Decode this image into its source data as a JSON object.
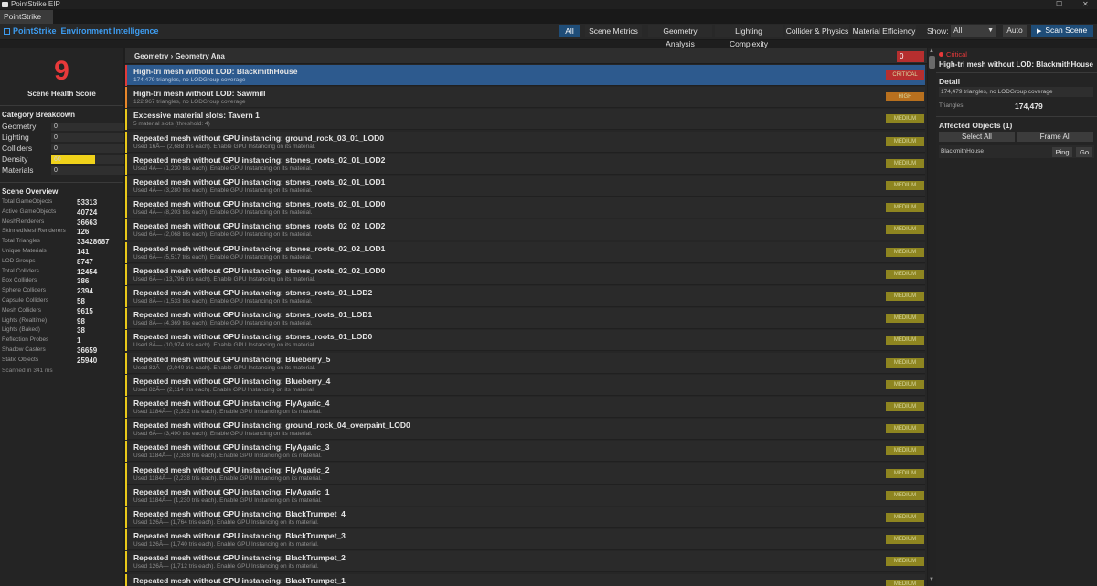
{
  "window": {
    "title": "PointStrike EIP",
    "tab": "PointStrike EIP"
  },
  "header": {
    "brand_prefix": "PointStrike",
    "brand_suffix": "Environment Intelligence",
    "nav": [
      "All",
      "Scene Metrics",
      "Geometry Analysis",
      "Lighting Complexity",
      "Collider & Physics",
      "Material Efficiency"
    ],
    "show_label": "Show:",
    "show_value": "All",
    "auto_label": "Auto",
    "scan_label": "Scan Scene"
  },
  "left": {
    "score": "9",
    "score_label": "Scene Health Score",
    "category_header": "Category Breakdown",
    "categories": [
      {
        "label": "Geometry",
        "value": "0",
        "fraction": 0.0
      },
      {
        "label": "Lighting",
        "value": "0",
        "fraction": 0.0
      },
      {
        "label": "Colliders",
        "value": "0",
        "fraction": 0.0
      },
      {
        "label": "Density",
        "value": "60",
        "fraction": 0.6
      },
      {
        "label": "Materials",
        "value": "0",
        "fraction": 0.0
      }
    ],
    "overview_header": "Scene Overview",
    "overview": [
      {
        "label": "Total GameObjects",
        "value": "53313"
      },
      {
        "label": "Active GameObjects",
        "value": "40724"
      },
      {
        "label": "MeshRenderers",
        "value": "36663"
      },
      {
        "label": "SkinnedMeshRenderers",
        "value": "126"
      },
      {
        "label": "Total Triangles",
        "value": "33428687"
      },
      {
        "label": "Unique Materials",
        "value": "141"
      },
      {
        "label": "LOD Groups",
        "value": "8747"
      },
      {
        "label": "Total Colliders",
        "value": "12454"
      },
      {
        "label": "Box Colliders",
        "value": "386"
      },
      {
        "label": "Sphere Colliders",
        "value": "2394"
      },
      {
        "label": "Capsule Colliders",
        "value": "58"
      },
      {
        "label": "Mesh Colliders",
        "value": "9615"
      },
      {
        "label": "Lights (Realtime)",
        "value": "98"
      },
      {
        "label": "Lights (Baked)",
        "value": "38"
      },
      {
        "label": "Reflection Probes",
        "value": "1"
      },
      {
        "label": "Shadow Casters",
        "value": "36659"
      },
      {
        "label": "Static Objects",
        "value": "25940"
      }
    ],
    "scanned": "Scanned in 341 ms"
  },
  "list": {
    "header": "Geometry  ›  Geometry Ana",
    "count": "0",
    "items": [
      {
        "title": "High-tri mesh without LOD: BlackmithHouse",
        "sub": "174,479 triangles, no LODGroup coverage",
        "severity": "CRITICAL",
        "color": "#e03a3a",
        "badge_bg": "#b62f2f",
        "selected": true
      },
      {
        "title": "High-tri mesh without LOD: Sawmill",
        "sub": "122,967 triangles, no LODGroup coverage",
        "severity": "HIGH",
        "color": "#e8862a",
        "badge_bg": "#b8701e",
        "selected": false
      },
      {
        "title": "Excessive material slots: Tavern 1",
        "sub": "5 material slots (threshold: 4)",
        "severity": "MEDIUM",
        "color": "#e8c81a",
        "badge_bg": "#8e8520",
        "selected": false
      },
      {
        "title": "Repeated mesh without GPU instancing: ground_rock_03_01_LOD0",
        "sub": "Used 16Ã— (2,688 tris each). Enable GPU Instancing on its material.",
        "severity": "MEDIUM",
        "color": "#e8c81a",
        "badge_bg": "#8e8520",
        "selected": false
      },
      {
        "title": "Repeated mesh without GPU instancing: stones_roots_02_01_LOD2",
        "sub": "Used 4Ã— (1,230 tris each). Enable GPU Instancing on its material.",
        "severity": "MEDIUM",
        "color": "#e8c81a",
        "badge_bg": "#8e8520",
        "selected": false
      },
      {
        "title": "Repeated mesh without GPU instancing: stones_roots_02_01_LOD1",
        "sub": "Used 4Ã— (3,280 tris each). Enable GPU Instancing on its material.",
        "severity": "MEDIUM",
        "color": "#e8c81a",
        "badge_bg": "#8e8520",
        "selected": false
      },
      {
        "title": "Repeated mesh without GPU instancing: stones_roots_02_01_LOD0",
        "sub": "Used 4Ã— (8,203 tris each). Enable GPU Instancing on its material.",
        "severity": "MEDIUM",
        "color": "#e8c81a",
        "badge_bg": "#8e8520",
        "selected": false
      },
      {
        "title": "Repeated mesh without GPU instancing: stones_roots_02_02_LOD2",
        "sub": "Used 6Ã— (2,068 tris each). Enable GPU Instancing on its material.",
        "severity": "MEDIUM",
        "color": "#e8c81a",
        "badge_bg": "#8e8520",
        "selected": false
      },
      {
        "title": "Repeated mesh without GPU instancing: stones_roots_02_02_LOD1",
        "sub": "Used 6Ã— (5,517 tris each). Enable GPU Instancing on its material.",
        "severity": "MEDIUM",
        "color": "#e8c81a",
        "badge_bg": "#8e8520",
        "selected": false
      },
      {
        "title": "Repeated mesh without GPU instancing: stones_roots_02_02_LOD0",
        "sub": "Used 6Ã— (13,796 tris each). Enable GPU Instancing on its material.",
        "severity": "MEDIUM",
        "color": "#e8c81a",
        "badge_bg": "#8e8520",
        "selected": false
      },
      {
        "title": "Repeated mesh without GPU instancing: stones_roots_01_LOD2",
        "sub": "Used 8Ã— (1,533 tris each). Enable GPU Instancing on its material.",
        "severity": "MEDIUM",
        "color": "#e8c81a",
        "badge_bg": "#8e8520",
        "selected": false
      },
      {
        "title": "Repeated mesh without GPU instancing: stones_roots_01_LOD1",
        "sub": "Used 8Ã— (4,369 tris each). Enable GPU Instancing on its material.",
        "severity": "MEDIUM",
        "color": "#e8c81a",
        "badge_bg": "#8e8520",
        "selected": false
      },
      {
        "title": "Repeated mesh without GPU instancing: stones_roots_01_LOD0",
        "sub": "Used 8Ã— (10,974 tris each). Enable GPU Instancing on its material.",
        "severity": "MEDIUM",
        "color": "#e8c81a",
        "badge_bg": "#8e8520",
        "selected": false
      },
      {
        "title": "Repeated mesh without GPU instancing: Blueberry_5",
        "sub": "Used 82Ã— (2,040 tris each). Enable GPU Instancing on its material.",
        "severity": "MEDIUM",
        "color": "#e8c81a",
        "badge_bg": "#8e8520",
        "selected": false
      },
      {
        "title": "Repeated mesh without GPU instancing: Blueberry_4",
        "sub": "Used 82Ã— (2,114 tris each). Enable GPU Instancing on its material.",
        "severity": "MEDIUM",
        "color": "#e8c81a",
        "badge_bg": "#8e8520",
        "selected": false
      },
      {
        "title": "Repeated mesh without GPU instancing: FlyAgaric_4",
        "sub": "Used 1184Ã— (2,392 tris each). Enable GPU Instancing on its material.",
        "severity": "MEDIUM",
        "color": "#e8c81a",
        "badge_bg": "#8e8520",
        "selected": false
      },
      {
        "title": "Repeated mesh without GPU instancing: ground_rock_04_overpaint_LOD0",
        "sub": "Used 6Ã— (3,490 tris each). Enable GPU Instancing on its material.",
        "severity": "MEDIUM",
        "color": "#e8c81a",
        "badge_bg": "#8e8520",
        "selected": false
      },
      {
        "title": "Repeated mesh without GPU instancing: FlyAgaric_3",
        "sub": "Used 1184Ã— (2,358 tris each). Enable GPU Instancing on its material.",
        "severity": "MEDIUM",
        "color": "#e8c81a",
        "badge_bg": "#8e8520",
        "selected": false
      },
      {
        "title": "Repeated mesh without GPU instancing: FlyAgaric_2",
        "sub": "Used 1184Ã— (2,238 tris each). Enable GPU Instancing on its material.",
        "severity": "MEDIUM",
        "color": "#e8c81a",
        "badge_bg": "#8e8520",
        "selected": false
      },
      {
        "title": "Repeated mesh without GPU instancing: FlyAgaric_1",
        "sub": "Used 1184Ã— (1,230 tris each). Enable GPU Instancing on its material.",
        "severity": "MEDIUM",
        "color": "#e8c81a",
        "badge_bg": "#8e8520",
        "selected": false
      },
      {
        "title": "Repeated mesh without GPU instancing: BlackTrumpet_4",
        "sub": "Used 126Ã— (1,764 tris each). Enable GPU Instancing on its material.",
        "severity": "MEDIUM",
        "color": "#e8c81a",
        "badge_bg": "#8e8520",
        "selected": false
      },
      {
        "title": "Repeated mesh without GPU instancing: BlackTrumpet_3",
        "sub": "Used 126Ã— (1,740 tris each). Enable GPU Instancing on its material.",
        "severity": "MEDIUM",
        "color": "#e8c81a",
        "badge_bg": "#8e8520",
        "selected": false
      },
      {
        "title": "Repeated mesh without GPU instancing: BlackTrumpet_2",
        "sub": "Used 126Ã— (1,712 tris each). Enable GPU Instancing on its material.",
        "severity": "MEDIUM",
        "color": "#e8c81a",
        "badge_bg": "#8e8520",
        "selected": false
      },
      {
        "title": "Repeated mesh without GPU instancing: BlackTrumpet_1",
        "sub": "",
        "severity": "MEDIUM",
        "color": "#e8c81a",
        "badge_bg": "#8e8520",
        "selected": false
      }
    ]
  },
  "right": {
    "severity": "Critical",
    "title": "High-tri mesh without LOD: BlackmithHouse",
    "detail_header": "Detail",
    "detail_text": "174,479 triangles, no LODGroup coverage",
    "tri_label": "Triangles",
    "tri_value": "174,479",
    "affected_header": "Affected Objects  (1)",
    "select_all": "Select All",
    "frame_all": "Frame All",
    "object": "BlackmithHouse",
    "ping": "Ping",
    "go": "Go"
  }
}
